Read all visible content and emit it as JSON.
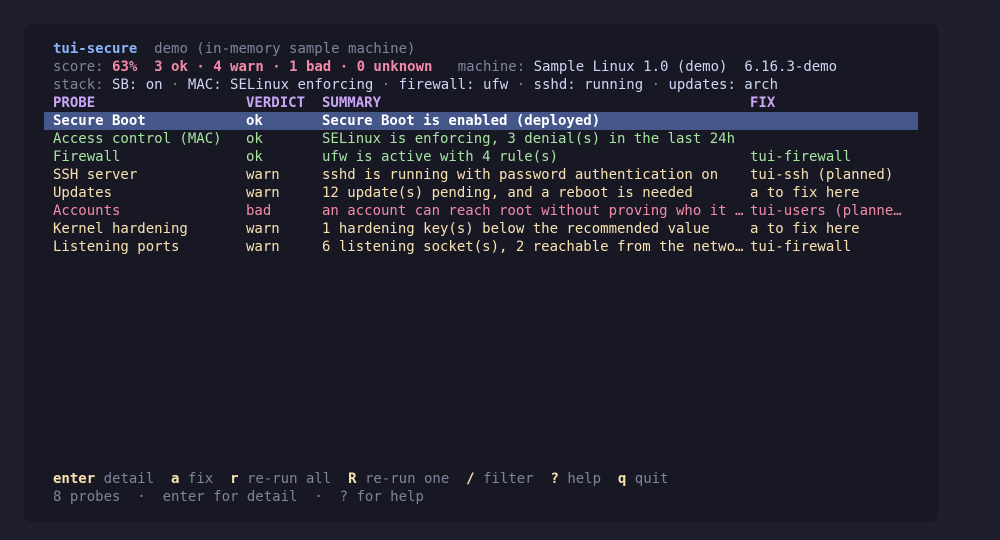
{
  "header": {
    "app_name": "tui-secure",
    "subtitle": "demo (in-memory sample machine)",
    "score_label": "score:",
    "score_value": "63%",
    "ok_text": "3 ok",
    "warn_text": "4 warn",
    "bad_text": "1 bad",
    "unknown_text": "0 unknown",
    "separator": "·",
    "machine_label": "machine:",
    "machine_value": "Sample Linux 1.0 (demo)",
    "kernel_value": "6.16.3-demo",
    "stack_label": "stack:",
    "stack_sb": "SB: on",
    "stack_mac": "MAC: SELinux enforcing",
    "stack_fw": "firewall: ufw",
    "stack_sshd": "sshd: running",
    "stack_updates": "updates: arch"
  },
  "table": {
    "columns": {
      "probe": "PROBE",
      "verdict": "VERDICT",
      "summary": "SUMMARY",
      "fix": "FIX"
    },
    "selected_index": 0,
    "rows": [
      {
        "probe": "Secure Boot",
        "verdict": "ok",
        "summary": "Secure Boot is enabled (deployed)",
        "fix": "",
        "status": "ok"
      },
      {
        "probe": "Access control (MAC)",
        "verdict": "ok",
        "summary": "SELinux is enforcing, 3 denial(s) in the last 24h",
        "fix": "",
        "status": "ok"
      },
      {
        "probe": "Firewall",
        "verdict": "ok",
        "summary": "ufw is active with 4 rule(s)",
        "fix": "tui-firewall",
        "status": "ok"
      },
      {
        "probe": "SSH server",
        "verdict": "warn",
        "summary": "sshd is running with password authentication on",
        "fix": "tui-ssh (planned)",
        "status": "warn"
      },
      {
        "probe": "Updates",
        "verdict": "warn",
        "summary": "12 update(s) pending, and a reboot is needed",
        "fix": "a to fix here",
        "status": "warn"
      },
      {
        "probe": "Accounts",
        "verdict": "bad",
        "summary": "an account can reach root without proving who it …",
        "fix": "tui-users (planne…",
        "status": "bad"
      },
      {
        "probe": "Kernel hardening",
        "verdict": "warn",
        "summary": "1 hardening key(s) below the recommended value",
        "fix": "a to fix here",
        "status": "warn"
      },
      {
        "probe": "Listening ports",
        "verdict": "warn",
        "summary": "6 listening socket(s), 2 reachable from the netwo…",
        "fix": "tui-firewall",
        "status": "warn"
      }
    ]
  },
  "keybar": [
    {
      "key": "enter",
      "action": "detail"
    },
    {
      "key": "a",
      "action": "fix"
    },
    {
      "key": "r",
      "action": "re-run all"
    },
    {
      "key": "R",
      "action": "re-run one"
    },
    {
      "key": "/",
      "action": "filter"
    },
    {
      "key": "?",
      "action": "help"
    },
    {
      "key": "q",
      "action": "quit"
    }
  ],
  "statusbar": {
    "count": "8 probes",
    "hint1": "enter for detail",
    "hint2": "? for help",
    "separator": "·"
  },
  "colors": {
    "ok": "#a6e3a1",
    "warn": "#f9e2af",
    "bad": "#f38ba8",
    "accent": "#89b4fa",
    "header": "#cba6f7",
    "selection": "#45568a"
  }
}
